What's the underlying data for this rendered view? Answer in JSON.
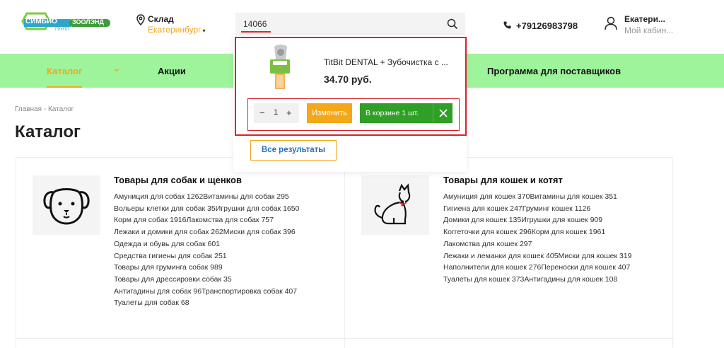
{
  "header": {
    "logo_word1": "СИМБИО",
    "logo_word2": "ЗООЛЭНД",
    "logo_sub": "ГРУПП",
    "location_label": "Склад",
    "location_city": "Екатеринбург",
    "location_caret": "▾",
    "search_value": "14066",
    "phone": "+79126983798",
    "user_name": "Екатери...",
    "user_sub": "Мой кабин..."
  },
  "nav": {
    "items": [
      "Каталог",
      "Акции",
      "Программа для поставщиков"
    ]
  },
  "breadcrumb": "Главная - Каталог",
  "page_title": "Каталог",
  "search_dropdown": {
    "product_name": "TitBit DENTAL + Зубочистка с ...",
    "product_price": "34.70 руб.",
    "quantity": "1",
    "minus": "−",
    "plus": "+",
    "change_label": "Изменить",
    "cart_label": "В корзине 1 шт.",
    "all_results_label": "Все результаты"
  },
  "catalog": {
    "dogs": {
      "title": "Товары для собак и щенков",
      "lines": [
        [
          "Амуниция для собак 1262",
          "Витамины для собак 295"
        ],
        [
          "Вольеры клетки для собак 35",
          "Игрушки для собак 1650"
        ],
        [
          "Корм для собак 1916",
          "Лакомства для собак 757"
        ],
        [
          "Лежаки и домики для собак 262",
          "Миски для собак 396"
        ],
        [
          "Одежда и обувь для собак 601"
        ],
        [
          "Средства гигиены для собак 251"
        ],
        [
          "Товары для груминга собак 989"
        ],
        [
          "Товары для дрессировки собак 35"
        ],
        [
          "Антигадины для собак 96",
          "Транспортировка собак 407"
        ],
        [
          "Туалеты для собак 68"
        ]
      ]
    },
    "cats": {
      "title": "Товары для кошек и котят",
      "lines": [
        [
          "Амуниция для кошек 370",
          "Витамины для кошек 351"
        ],
        [
          "Гигиена для кошек 247",
          "Груминг кошек 1126"
        ],
        [
          "Домики для кошек 135",
          "Игрушки для кошек 909"
        ],
        [
          "Коггеточки для кошек 296",
          "Корм для кошек 1961"
        ],
        [
          "Лакомства для кошек 297"
        ],
        [
          "Лежаки и леманки для кошек 405",
          "Миски для кошек 319"
        ],
        [
          "Наполнители для кошек 276",
          "Переноски для кошек 407"
        ],
        [
          "Туалеты для кошек 373",
          "Антигадины для кошек 108"
        ]
      ]
    }
  },
  "colors": {
    "accent_orange": "#f3a71b",
    "nav_green": "#9ef49b",
    "cart_green": "#2f9f25",
    "highlight_red": "#d6242b"
  }
}
